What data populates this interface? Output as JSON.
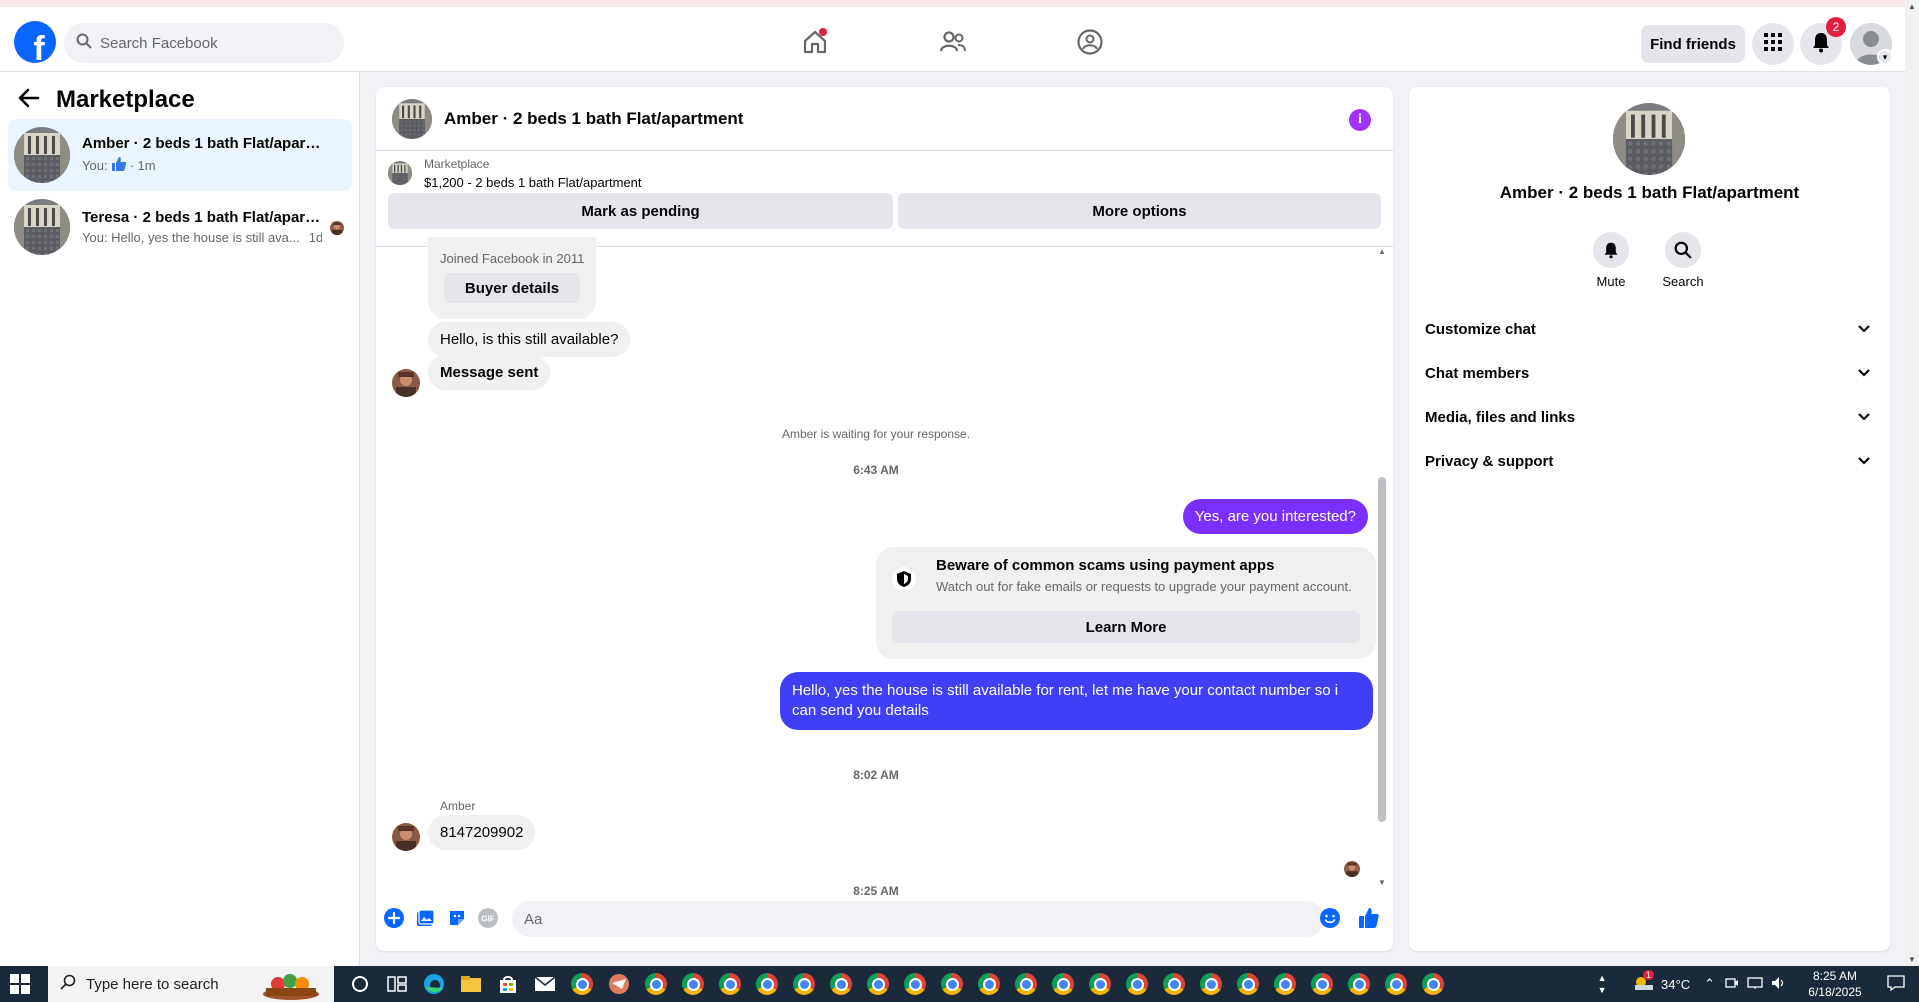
{
  "topbar": {
    "search_placeholder": "Search Facebook",
    "find_friends": "Find friends",
    "notification_count": "2"
  },
  "sidebar": {
    "title": "Marketplace",
    "conversations": [
      {
        "name": "Amber · 2 beds 1 bath Flat/apartm...",
        "preview_prefix": "You:",
        "preview_time": "· 1m"
      },
      {
        "name": "Teresa · 2 beds 1 bath Flat/apart...",
        "preview": "You: Hello, yes the house is still ava...",
        "preview_time": "1d"
      }
    ]
  },
  "chat": {
    "title": "Amber · 2 beds 1 bath Flat/apartment",
    "listing": {
      "source": "Marketplace",
      "price_title": "$1,200 - 2 beds 1 bath Flat/apartment",
      "mark_pending": "Mark as pending",
      "more_options": "More options"
    },
    "buyer": {
      "joined": "Joined Facebook in 2011",
      "details_button": "Buyer details"
    },
    "messages": {
      "m1": "Hello, is this still available?",
      "m2": "Message sent",
      "waiting_note": "Amber is waiting for your response.",
      "time1": "6:43 AM",
      "out1": "Yes, are you interested?",
      "scam_title": "Beware of common scams using payment apps",
      "scam_desc": "Watch out for fake emails or requests to upgrade your payment account.",
      "learn_more": "Learn More",
      "out2": "Hello, yes the house is still available for rent, let me have your contact number so i can send you details",
      "time2": "8:02 AM",
      "sender": "Amber",
      "in3": "8147209902",
      "time3": "8:25 AM"
    },
    "composer_placeholder": "Aa"
  },
  "info_panel": {
    "name": "Amber · 2 beds 1 bath Flat/apartment",
    "actions": {
      "mute": "Mute",
      "search": "Search"
    },
    "sections": [
      "Customize chat",
      "Chat members",
      "Media, files and links",
      "Privacy & support"
    ]
  },
  "taskbar": {
    "search_placeholder": "Type here to search",
    "weather_temp": "34°C",
    "weather_badge": "1",
    "time": "8:25 AM",
    "date": "6/18/2025"
  },
  "colors": {
    "fb_blue": "#0866ff",
    "messenger_purple": "#7b2ffe",
    "messenger_blue": "#3f3ff5",
    "info_purple": "#a033ff",
    "notif_red": "#e41e3f"
  }
}
